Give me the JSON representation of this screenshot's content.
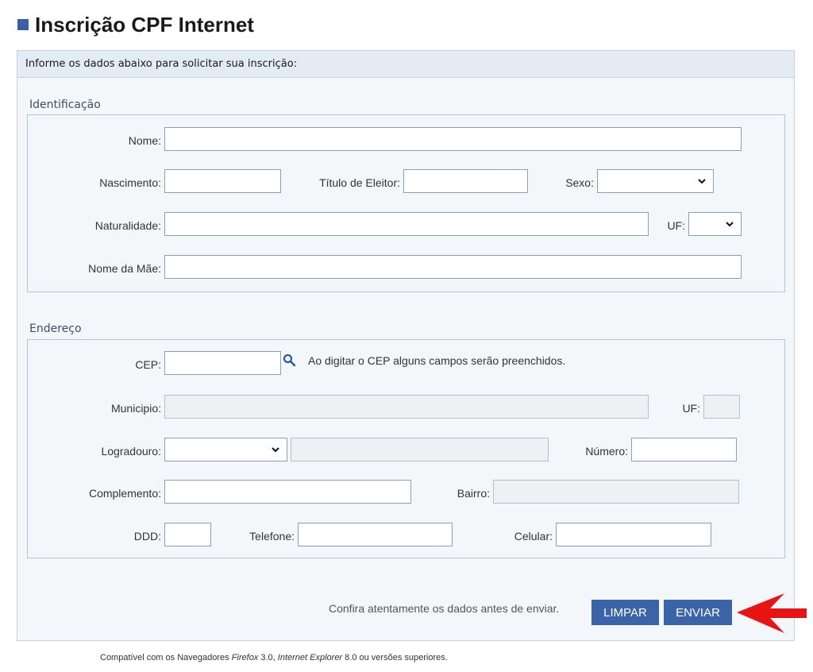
{
  "page": {
    "title": "Inscrição CPF Internet"
  },
  "panel": {
    "header": "Informe os dados abaixo para solicitar sua inscrição:"
  },
  "identificacao": {
    "legend": "Identificação",
    "nome_label": "Nome:",
    "nascimento_label": "Nascimento:",
    "titulo_label": "Título de Eleitor:",
    "sexo_label": "Sexo:",
    "naturalidade_label": "Naturalidade:",
    "uf_label": "UF:",
    "mae_label": "Nome da Mãe:"
  },
  "endereco": {
    "legend": "Endereço",
    "cep_label": "CEP:",
    "cep_hint": "Ao digitar o CEP alguns campos serão preenchidos.",
    "municipio_label": "Municipio:",
    "uf_label": "UF:",
    "logradouro_label": "Logradouro:",
    "numero_label": "Número:",
    "complemento_label": "Complemento:",
    "bairro_label": "Bairro:",
    "ddd_label": "DDD:",
    "telefone_label": "Telefone:",
    "celular_label": "Celular:"
  },
  "actions": {
    "confirm_text": "Confira atentamente os dados antes de enviar.",
    "limpar_label": "LIMPAR",
    "enviar_label": "ENVIAR"
  },
  "footer": {
    "prefix": "Compatível com os Navegadores ",
    "browser1": "Firefox",
    "v1": " 3.0, ",
    "browser2": "Internet Explorer",
    "v2": " 8.0 ou versões superiores."
  },
  "icons": {
    "search": "search-icon",
    "chevron": "chevron-down-icon",
    "arrow": "red-arrow-icon"
  },
  "colors": {
    "accent": "#3a63a8",
    "arrow": "#e81414"
  }
}
